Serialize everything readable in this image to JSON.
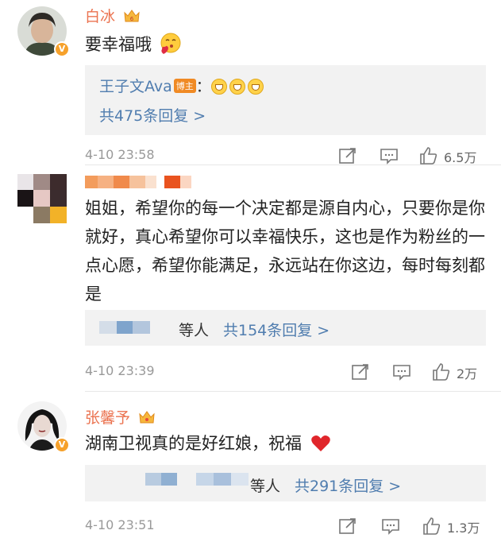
{
  "comments": [
    {
      "username": "白冰",
      "text": "要幸福哦",
      "reply": {
        "author": "王子文Ava",
        "author_tag": "博主",
        "separator": "：",
        "summary": "共475条回复 >"
      },
      "time": "4-10 23:58",
      "likes": "6.5万"
    },
    {
      "username": "",
      "text": "姐姐，希望你的每一个决定都是源自内心，只要你是你就好，真心希望你可以幸福快乐，这也是作为粉丝的一点心愿，希望你能满足，永远站在你这边，每时每刻都是",
      "reply": {
        "others": "等人",
        "summary": "共154条回复 >"
      },
      "time": "4-10 23:39",
      "likes": "2万"
    },
    {
      "username": "张馨予",
      "text": "湖南卫视真的是好红娘，祝福",
      "reply": {
        "others": "等人",
        "summary": "共291条回复 >"
      },
      "time": "4-10 23:51",
      "likes": "1.3万"
    }
  ],
  "icons": [
    "crown-icon",
    "verified-icon",
    "share-icon",
    "comment-icon",
    "like-icon",
    "heart-icon",
    "kiss-emoji-icon",
    "grin-emoji-icon"
  ],
  "colors": {
    "username": "#eb7350",
    "link": "#507daf",
    "time": "#999999",
    "reply_bg": "#f2f2f2",
    "heart": "#e0262b",
    "vbadge": "#f6a12b"
  }
}
